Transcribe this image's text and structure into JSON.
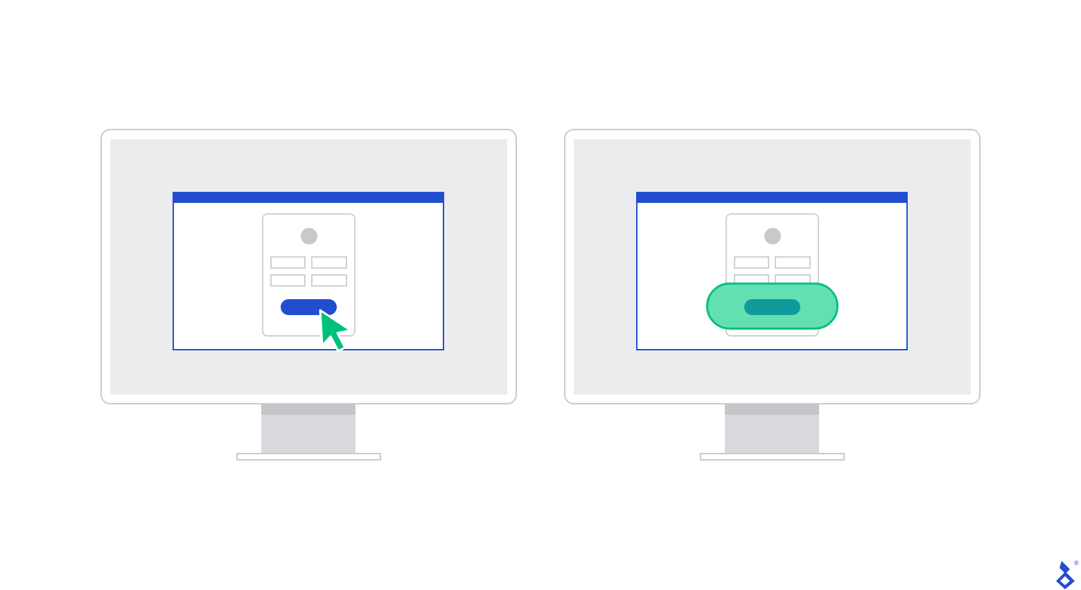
{
  "colors": {
    "brand": "#204ecf",
    "accent_green": "#00c17a",
    "tap_zone_fill": "#63e0b1",
    "tap_zone_button": "#0f9b9b"
  },
  "monitors": [
    {
      "state": "click-target-normal",
      "cursor": "pointer-arrow-icon"
    },
    {
      "state": "click-target-enlarged",
      "highlight": "expanded-tap-zone"
    }
  ],
  "logo": {
    "icon": "toptal-logo-icon",
    "mark": "®"
  }
}
